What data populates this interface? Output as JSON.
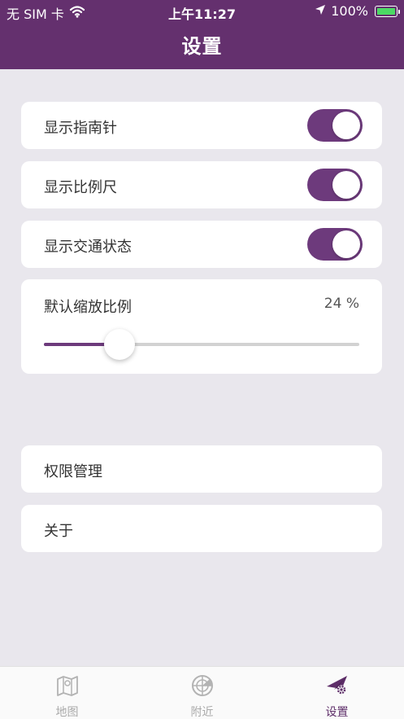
{
  "status_bar": {
    "carrier": "无 SIM 卡",
    "time": "上午11:27",
    "battery": "100%"
  },
  "header": {
    "title": "设置"
  },
  "settings": {
    "show_compass": {
      "label": "显示指南针",
      "on": true
    },
    "show_scale": {
      "label": "显示比例尺",
      "on": true
    },
    "show_traffic": {
      "label": "显示交通状态",
      "on": true
    },
    "default_zoom": {
      "label": "默认缩放比例",
      "value_text": "24 %",
      "value": 24
    }
  },
  "menu": {
    "permissions": "权限管理",
    "about": "关于"
  },
  "tabs": [
    {
      "label": "地图",
      "icon": "map-icon",
      "active": false
    },
    {
      "label": "附近",
      "icon": "radar-icon",
      "active": false
    },
    {
      "label": "设置",
      "icon": "settings-plane-icon",
      "active": true
    }
  ],
  "colors": {
    "header": "#64306e",
    "accent": "#6d3a7c",
    "background": "#e9e7ed"
  }
}
